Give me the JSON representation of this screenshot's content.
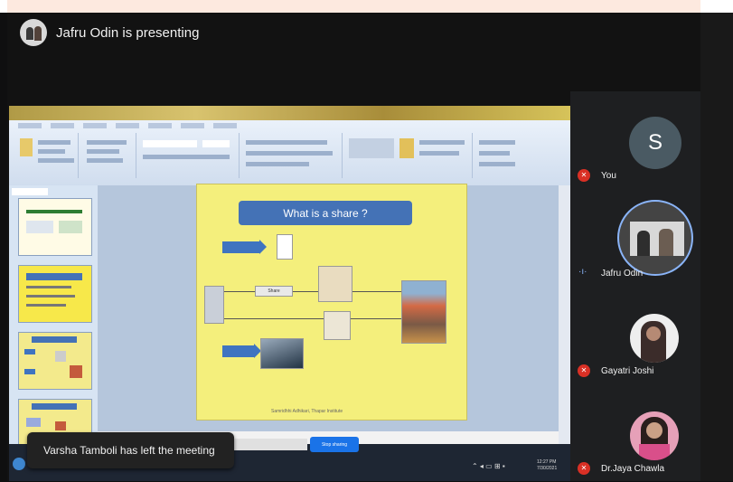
{
  "meeting": {
    "presenter_text": "Jafru Odin is presenting",
    "notification": "Varsha Tamboli has left the meeting"
  },
  "shared_screen": {
    "slide_title": "What is a share ?",
    "slide_label_share": "Share",
    "slide_footer": "Samridhhi Adhikari, Thapar Institute",
    "present_button": "Stop sharing",
    "taskbar_time": "12:27 PM",
    "taskbar_date": "7/30/2021"
  },
  "participants": [
    {
      "name": "You",
      "avatar_letter": "S",
      "muted": true
    },
    {
      "name": "Jafru Odin",
      "muted": false,
      "speaking": true
    },
    {
      "name": "Gayatri Joshi",
      "muted": true
    },
    {
      "name": "Dr.Jaya Chawla",
      "muted": true
    }
  ],
  "colors": {
    "background": "#121212",
    "tile": "#1e1f21",
    "mic_off": "#d93025",
    "speaking": "#8ab4f8",
    "slide_bg": "#f4ef7c",
    "slide_title_bg": "#4472b6"
  }
}
